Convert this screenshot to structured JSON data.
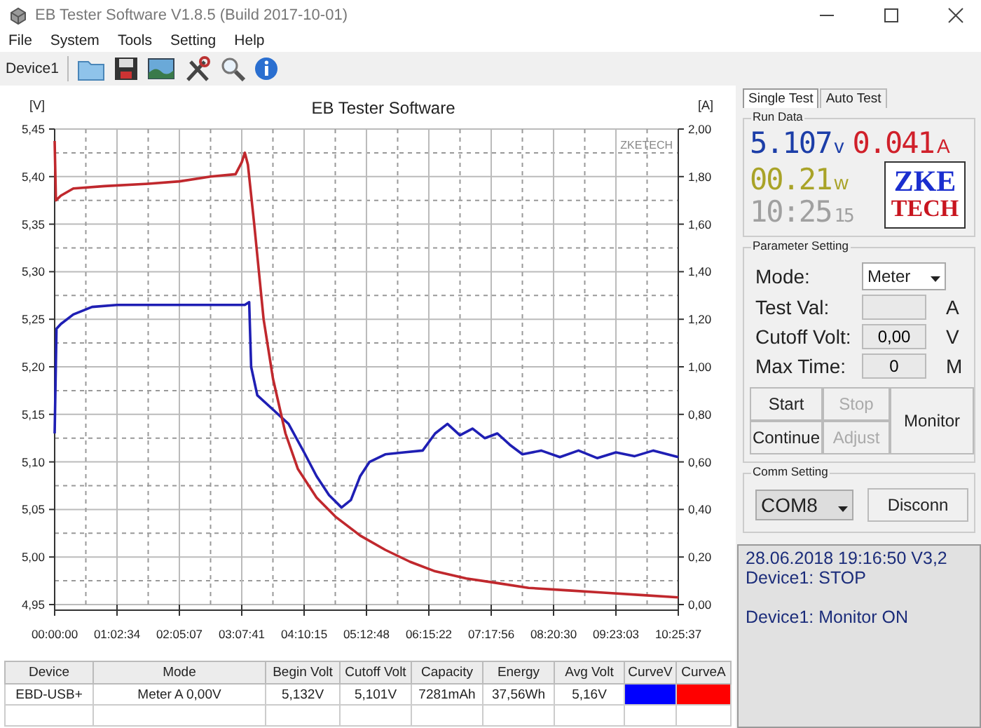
{
  "window": {
    "title": "EB Tester Software V1.8.5 (Build 2017-10-01)"
  },
  "menu": [
    "File",
    "System",
    "Tools",
    "Setting",
    "Help"
  ],
  "toolbar": {
    "device": "Device1"
  },
  "chart": {
    "chart_data": {
      "type": "line",
      "title": "EB Tester Software",
      "ylabel": "[V]",
      "y2label": "[A]",
      "ylim": [
        4.95,
        5.45
      ],
      "y2lim": [
        0,
        2
      ],
      "yticks": [
        {
          "value": 4.95,
          "label": "4,95"
        },
        {
          "value": 5.0,
          "label": "5,00"
        },
        {
          "value": 5.05,
          "label": "5,05"
        },
        {
          "value": 5.1,
          "label": "5,10"
        },
        {
          "value": 5.15,
          "label": "5,15"
        },
        {
          "value": 5.2,
          "label": "5,20"
        },
        {
          "value": 5.25,
          "label": "5,25"
        },
        {
          "value": 5.3,
          "label": "5,30"
        },
        {
          "value": 5.35,
          "label": "5,35"
        },
        {
          "value": 5.4,
          "label": "5,40"
        },
        {
          "value": 5.45,
          "label": "5,45"
        }
      ],
      "y2ticks": [
        {
          "value": 0,
          "label": "0,00"
        },
        {
          "value": 0.2,
          "label": "0,20"
        },
        {
          "value": 0.4,
          "label": "0,40"
        },
        {
          "value": 0.6,
          "label": "0,60"
        },
        {
          "value": 0.8,
          "label": "0,80"
        },
        {
          "value": 1.0,
          "label": "1,00"
        },
        {
          "value": 1.2,
          "label": "1,20"
        },
        {
          "value": 1.4,
          "label": "1,40"
        },
        {
          "value": 1.6,
          "label": "1,60"
        },
        {
          "value": 1.8,
          "label": "1,80"
        },
        {
          "value": 2.0,
          "label": "2,00"
        }
      ],
      "xlim": [
        0,
        37537
      ],
      "xticks": [
        {
          "value": 0,
          "label": "00:00:00"
        },
        {
          "value": 3754,
          "label": "01:02:34"
        },
        {
          "value": 7507,
          "label": "02:05:07"
        },
        {
          "value": 11261,
          "label": "03:07:41"
        },
        {
          "value": 15015,
          "label": "04:10:15"
        },
        {
          "value": 18768,
          "label": "05:12:48"
        },
        {
          "value": 22522,
          "label": "06:15:22"
        },
        {
          "value": 26276,
          "label": "07:17:56"
        },
        {
          "value": 30030,
          "label": "08:20:30"
        },
        {
          "value": 33783,
          "label": "09:23:03"
        },
        {
          "value": 37537,
          "label": "10:25:37"
        }
      ],
      "series": [
        {
          "color": "#1f1fb4",
          "x": [
            0,
            113,
            375,
            1126,
            2252,
            3754,
            7507,
            11449,
            11712,
            11824,
            12200,
            13138,
            14078,
            15015,
            15767,
            16516,
            17267,
            17830,
            18393,
            18956,
            19895,
            21021,
            22147,
            22898,
            23648,
            24399,
            25150,
            25900,
            26651,
            27402,
            28153,
            29279,
            30405,
            31531,
            32657,
            33783,
            34910,
            36036,
            37537
          ],
          "values": [
            5.13,
            5.24,
            5.245,
            5.255,
            5.263,
            5.265,
            5.265,
            5.265,
            5.268,
            5.2,
            5.17,
            5.155,
            5.14,
            5.11,
            5.085,
            5.065,
            5.052,
            5.06,
            5.085,
            5.1,
            5.108,
            5.11,
            5.112,
            5.13,
            5.14,
            5.128,
            5.135,
            5.125,
            5.13,
            5.118,
            5.108,
            5.112,
            5.105,
            5.112,
            5.104,
            5.11,
            5.106,
            5.112,
            5.105
          ]
        },
        {
          "color": "#c0282d",
          "axis": "y2",
          "x": [
            0,
            75,
            375,
            1126,
            3003,
            5631,
            7507,
            9384,
            10886,
            11261,
            11449,
            11636,
            12012,
            12575,
            13138,
            13889,
            14640,
            15766,
            16892,
            18393,
            19895,
            21396,
            22898,
            24774,
            26651,
            28528,
            30780,
            33033,
            35285,
            37537
          ],
          "values": [
            1.95,
            1.7,
            1.72,
            1.75,
            1.76,
            1.77,
            1.78,
            1.8,
            1.81,
            1.86,
            1.9,
            1.85,
            1.6,
            1.2,
            0.95,
            0.72,
            0.57,
            0.45,
            0.37,
            0.29,
            0.23,
            0.18,
            0.14,
            0.11,
            0.09,
            0.07,
            0.06,
            0.05,
            0.04,
            0.03
          ]
        }
      ],
      "annotations": [
        "ZKETECH"
      ],
      "grid": true
    }
  },
  "table": {
    "columns": [
      "Device",
      "Mode",
      "Begin Volt",
      "Cutoff Volt",
      "Capacity",
      "Energy",
      "Avg Volt",
      "CurveV",
      "CurveA"
    ],
    "rows": [
      {
        "cells": [
          "EBD-USB+",
          "Meter  A  0,00V",
          "5,132V",
          "5,101V",
          "7281mAh",
          "37,56Wh",
          "5,16V"
        ],
        "swatches": [
          {
            "color": "#0000ff"
          },
          {
            "color": "#ff0000"
          }
        ]
      }
    ]
  },
  "tabs": [
    {
      "label": "Single Test",
      "selected": true
    },
    {
      "label": "Auto Test",
      "selected": false
    }
  ],
  "run_data": {
    "title": "Run Data",
    "voltage": "5.107",
    "voltage_unit": "v",
    "current": "0.041",
    "current_unit": "A",
    "power": "00.21",
    "power_unit": "w",
    "time": "10:25",
    "seconds": "15",
    "logo": [
      "ZKE",
      "TECH"
    ]
  },
  "parameters": {
    "title": "Parameter Setting",
    "mode": {
      "label": "Mode:",
      "value": "Meter"
    },
    "fields": [
      {
        "label": "Test Val:",
        "unit": "A"
      },
      {
        "label": "Cutoff Volt:",
        "value": "0,00",
        "unit": "V"
      },
      {
        "label": "Max Time:",
        "value": "0",
        "unit": "M"
      }
    ],
    "buttons": [
      {
        "label": "Start",
        "disabled": false
      },
      {
        "label": "Stop",
        "disabled": true
      },
      {
        "label": "Continue",
        "disabled": false
      },
      {
        "label": "Adjust",
        "disabled": true
      }
    ],
    "monitor": "Monitor"
  },
  "comm": {
    "title": "Comm Setting",
    "port": "COM8",
    "button": "Disconn"
  },
  "log": [
    [
      "28.06.2018 19:16:50  V3,2",
      "Device1: STOP"
    ],
    [
      "Device1: Monitor ON"
    ]
  ]
}
